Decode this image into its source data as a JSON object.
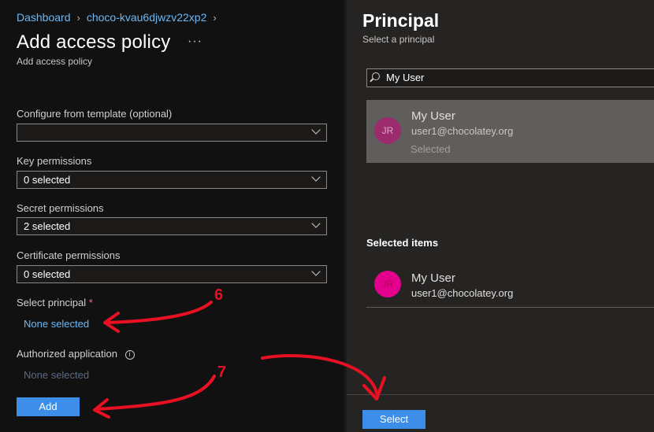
{
  "breadcrumb": {
    "items": [
      "Dashboard",
      "choco-kvau6djwzv22xp2"
    ]
  },
  "left": {
    "title": "Add access policy",
    "more": "···",
    "subtitle": "Add access policy",
    "template_label": "Configure from template (optional)",
    "template_value": "",
    "key_label": "Key permissions",
    "key_value": "0 selected",
    "secret_label": "Secret permissions",
    "secret_value": "2 selected",
    "cert_label": "Certificate permissions",
    "cert_value": "0 selected",
    "principal_label": "Select principal",
    "principal_required": "*",
    "principal_link": "None selected",
    "app_label": "Authorized application",
    "app_info_icon": "i",
    "app_link": "None selected",
    "add_button": "Add"
  },
  "right": {
    "title": "Principal",
    "subtitle": "Select a principal",
    "search_value": "My User",
    "result": {
      "initials": "JR",
      "name": "My User",
      "email": "user1@chocolatey.org",
      "status": "Selected"
    },
    "selected_heading": "Selected items",
    "selected_item": {
      "initials": "JR",
      "name": "My User",
      "email": "user1@chocolatey.org"
    },
    "select_button": "Select"
  },
  "annotations": {
    "step6": "6",
    "step7": "7",
    "color": "#e81123"
  },
  "colors": {
    "accent": "#3c8ee8",
    "link": "#6cb8f6",
    "avatar_result": "#9b2b6d",
    "avatar_selected": "#e3008c"
  }
}
